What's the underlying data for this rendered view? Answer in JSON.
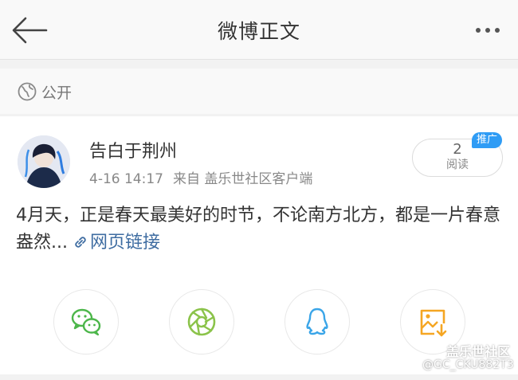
{
  "header": {
    "title": "微博正文",
    "back_icon": "arrow-left-icon",
    "more_icon": "more-dots-icon"
  },
  "visibility": {
    "icon": "globe-icon",
    "label": "公开"
  },
  "post": {
    "author": "告白于荆州",
    "time": "4-16 14:17",
    "source": "来自 盖乐世社区客户端",
    "reads_count": "2",
    "reads_label": "阅读",
    "badge": "推广",
    "text": "4月天，正是春天最美好的时节，不论南方北方，都是一片春意盎然...",
    "link_label": "网页链接"
  },
  "share": {
    "items": [
      {
        "name": "wechat",
        "icon": "wechat-icon",
        "color": "#4cb64a"
      },
      {
        "name": "moments",
        "icon": "moments-aperture-icon",
        "color": "#8bc34a"
      },
      {
        "name": "qq",
        "icon": "qq-penguin-icon",
        "color": "#3aa5e8"
      },
      {
        "name": "save-image",
        "icon": "save-image-icon",
        "color": "#f5a623"
      }
    ]
  },
  "watermark": {
    "title": "盖乐世社区",
    "user": "@GC_CKU882T3"
  }
}
